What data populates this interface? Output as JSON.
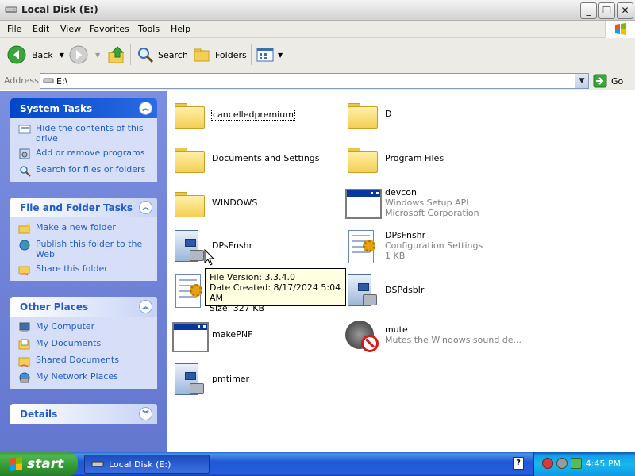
{
  "window": {
    "title": "Local Disk (E:)",
    "controls": {
      "minimize": "_",
      "maximize": "❐",
      "close": "✕"
    }
  },
  "menu": [
    "File",
    "Edit",
    "View",
    "Favorites",
    "Tools",
    "Help"
  ],
  "toolbar": {
    "back_label": "Back",
    "search_label": "Search",
    "folders_label": "Folders"
  },
  "address": {
    "label": "Address",
    "value": "E:\\",
    "go_label": "Go"
  },
  "panels": {
    "system_tasks": {
      "title": "System Tasks",
      "items": [
        {
          "label": "Hide the contents of this drive",
          "icon": "hide-contents-icon"
        },
        {
          "label": "Add or remove programs",
          "icon": "add-remove-programs-icon"
        },
        {
          "label": "Search for files or folders",
          "icon": "search-icon"
        }
      ]
    },
    "file_folder_tasks": {
      "title": "File and Folder Tasks",
      "items": [
        {
          "label": "Make a new folder",
          "icon": "new-folder-icon"
        },
        {
          "label": "Publish this folder to the Web",
          "icon": "globe-icon"
        },
        {
          "label": "Share this folder",
          "icon": "share-folder-icon"
        }
      ]
    },
    "other_places": {
      "title": "Other Places",
      "items": [
        {
          "label": "My Computer",
          "icon": "computer-icon"
        },
        {
          "label": "My Documents",
          "icon": "documents-icon"
        },
        {
          "label": "Shared Documents",
          "icon": "shared-documents-icon"
        },
        {
          "label": "My Network Places",
          "icon": "network-icon"
        }
      ]
    },
    "details": {
      "title": "Details"
    }
  },
  "files": [
    {
      "name": "cancelledpremium",
      "type": "folder"
    },
    {
      "name": "D",
      "type": "folder"
    },
    {
      "name": "Documents and Settings",
      "type": "folder"
    },
    {
      "name": "Program Files",
      "type": "folder"
    },
    {
      "name": "WINDOWS",
      "type": "folder"
    },
    {
      "name": "devcon",
      "type": "application",
      "line2": "Windows Setup API",
      "line3": "Microsoft Corporation"
    },
    {
      "name": "DPsFnshr",
      "type": "setup-application"
    },
    {
      "name": "DPsFnshr",
      "type": "configuration-settings",
      "line2": "Configuration Settings",
      "line3": "1 KB"
    },
    {
      "name": "",
      "type": "configuration-settings"
    },
    {
      "name": "DSPdsblr",
      "type": "setup-application"
    },
    {
      "name": "makePNF",
      "type": "application"
    },
    {
      "name": "mute",
      "type": "muted-speaker",
      "line2": "Mutes the Windows sound de..."
    },
    {
      "name": "pmtimer",
      "type": "setup-application"
    }
  ],
  "tooltip": {
    "line1": "File Version: 3.3.4.0",
    "line2": "Date Created: 8/17/2024 5:04 AM",
    "line3": "Size: 327 KB"
  },
  "taskbar": {
    "start_label": "start",
    "task_label": "Local Disk (E:)",
    "clock": "4:45 PM"
  }
}
